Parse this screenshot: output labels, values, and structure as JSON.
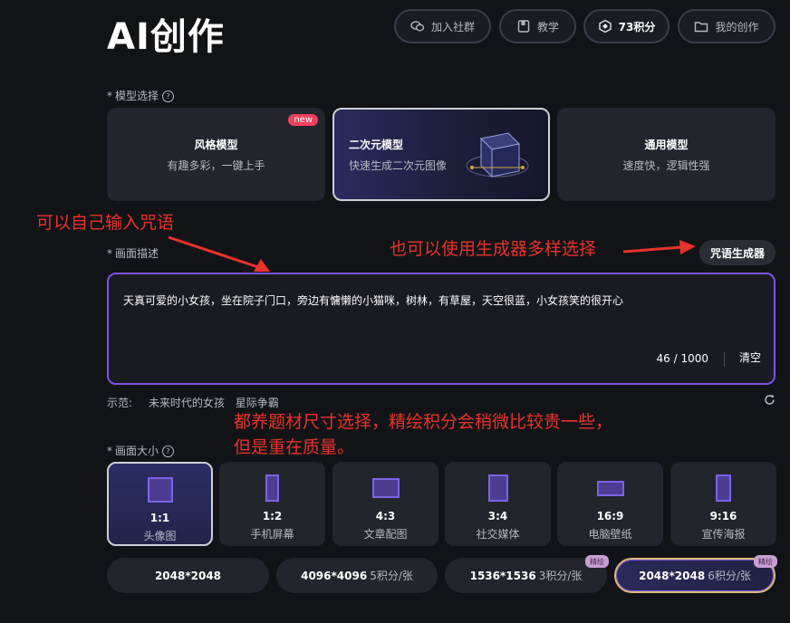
{
  "header": {
    "title": "AI创作",
    "buttons": [
      {
        "label": "加入社群",
        "icon": "chat-group-icon"
      },
      {
        "label": "教学",
        "icon": "book-icon"
      },
      {
        "label": "73积分",
        "icon": "points-hexagon-icon"
      },
      {
        "label": "我的创作",
        "icon": "folder-icon"
      }
    ]
  },
  "model_section": {
    "label": "模型选择",
    "models": [
      {
        "title": "风格模型",
        "subtitle": "有趣多彩，一键上手",
        "badge": "new"
      },
      {
        "title": "二次元模型",
        "subtitle": "快速生成二次元图像",
        "selected": true
      },
      {
        "title": "通用模型",
        "subtitle": "速度快，逻辑性强"
      }
    ]
  },
  "annotations": {
    "left": "可以自己输入咒语",
    "right": "也可以使用生成器多样选择",
    "middle_line1": "都养题材尺寸选择，精绘积分会稍微比较贵一些，",
    "middle_line2": "但是重在质量。"
  },
  "prompt_section": {
    "label": "画面描述",
    "generator_button": "咒语生成器",
    "text": "天真可爱的小女孩，坐在院子门口，旁边有慵懒的小猫咪，树林，有草屋，天空很蓝，小女孩笑的很开心",
    "counter": "46 / 1000",
    "clear_label": "清空"
  },
  "examples": {
    "label": "示范:",
    "items": [
      "未来时代的女孩",
      "星际争霸"
    ]
  },
  "size_section": {
    "label": "画面大小",
    "sizes": [
      {
        "ratio": "1:1",
        "name": "头像图",
        "selected": true
      },
      {
        "ratio": "1:2",
        "name": "手机屏幕"
      },
      {
        "ratio": "4:3",
        "name": "文章配图"
      },
      {
        "ratio": "3:4",
        "name": "社交媒体"
      },
      {
        "ratio": "16:9",
        "name": "电脑壁纸"
      },
      {
        "ratio": "9:16",
        "name": "宣传海报"
      }
    ]
  },
  "resolutions": [
    {
      "size": "2048*2048",
      "cost": ""
    },
    {
      "size": "4096*4096",
      "cost": "5积分/张"
    },
    {
      "size": "1536*1536",
      "cost": "3积分/张",
      "badge": "精绘"
    },
    {
      "size": "2048*2048",
      "cost": "6积分/张",
      "badge": "精绘",
      "selected": true
    }
  ],
  "colors": {
    "accent": "#7b55e0",
    "annotation": "#e8332a",
    "background": "#121317"
  }
}
